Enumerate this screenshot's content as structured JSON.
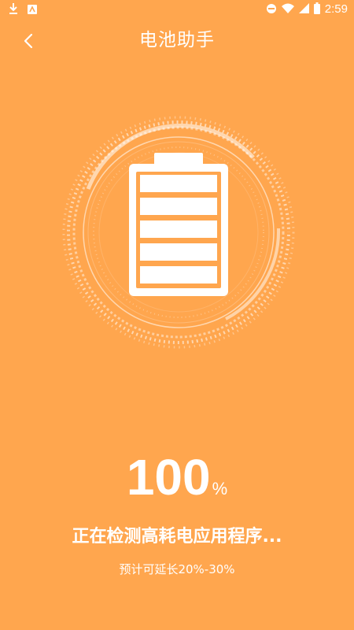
{
  "colors": {
    "background": "#FFA64E",
    "foreground": "#FFFFFF"
  },
  "status_bar": {
    "time": "2:59",
    "left_icons": [
      "download-icon",
      "app-notification-icon"
    ],
    "right_icons": [
      "do-not-disturb-icon",
      "wifi-icon",
      "cellular-signal-icon",
      "battery-icon"
    ]
  },
  "app_bar": {
    "back_icon": "chevron-left-icon",
    "title": "电池助手"
  },
  "battery": {
    "icon": "battery-full-icon",
    "segments": 5
  },
  "progress": {
    "value": "100",
    "unit": "%"
  },
  "status": {
    "message": "正在检测高耗电应用程序...",
    "estimate": "预计可延长20%-30%"
  }
}
